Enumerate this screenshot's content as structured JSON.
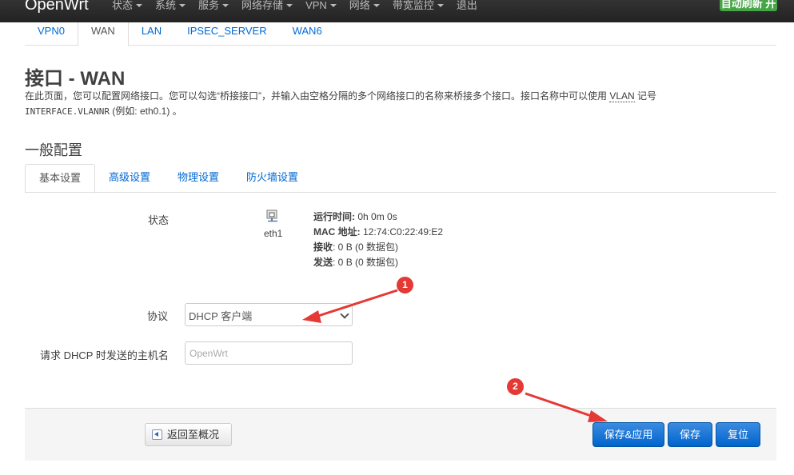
{
  "nav": {
    "brand": "OpenWrt",
    "menu": [
      "状态",
      "系统",
      "服务",
      "网络存储",
      "VPN",
      "网络",
      "带宽监控",
      "退出"
    ],
    "auto_refresh": "自动刷新 开"
  },
  "interface_tabs": [
    "VPN0",
    "WAN",
    "LAN",
    "IPSEC_SERVER",
    "WAN6"
  ],
  "page": {
    "title": "接口 - WAN",
    "desc_part1": "在此页面，您可以配置网络接口。您可以勾选“桥接接口”，并输入由空格分隔的多个网络接口的名称来桥接多个接口。接口名称中可以使用 ",
    "desc_abbr": "VLAN",
    "desc_part2": " 记号",
    "desc_mono": "INTERFACE.VLANNR",
    "desc_part3": " (例如: eth0.1) 。"
  },
  "general": {
    "title": "一般配置",
    "tabs": [
      "基本设置",
      "高级设置",
      "物理设置",
      "防火墙设置"
    ]
  },
  "status": {
    "label": "状态",
    "ifname": "eth1",
    "uptime_label": "运行时间:",
    "uptime": " 0h 0m 0s",
    "mac_label": "MAC 地址:",
    "mac": " 12:74:C0:22:49:E2",
    "rx_label": "接收",
    "rx": ": 0 B (0 数据包)",
    "tx_label": "发送",
    "tx": ": 0 B (0 数据包)"
  },
  "protocol": {
    "label": "协议",
    "value": "DHCP 客户端"
  },
  "hostname": {
    "label": "请求 DHCP 时发送的主机名",
    "placeholder": "OpenWrt"
  },
  "footer": {
    "back": "返回至概况",
    "save_apply": "保存&应用",
    "save": "保存",
    "reset": "复位"
  },
  "annotations": {
    "one": "1",
    "two": "2"
  },
  "colors": {
    "link": "#0069d6",
    "primary": "#0064cd",
    "annotation": "#e53935",
    "refresh_badge": "#46a546"
  }
}
